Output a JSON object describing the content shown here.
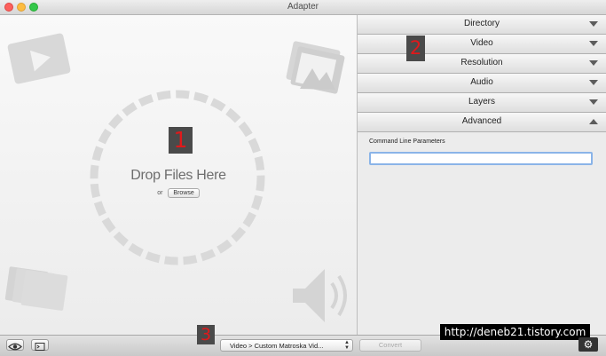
{
  "window": {
    "title": "Adapter"
  },
  "dropzone": {
    "heading": "Drop Files Here",
    "or_text": "or",
    "browse_label": "Browse"
  },
  "annotations": {
    "one": "1",
    "two": "2",
    "three": "3"
  },
  "sections": [
    {
      "label": "Directory",
      "expanded": false
    },
    {
      "label": "Video",
      "expanded": false
    },
    {
      "label": "Resolution",
      "expanded": false
    },
    {
      "label": "Audio",
      "expanded": false
    },
    {
      "label": "Layers",
      "expanded": false
    },
    {
      "label": "Advanced",
      "expanded": true
    }
  ],
  "advanced": {
    "command_line_label": "Command Line Parameters",
    "command_line_value": ""
  },
  "bottom": {
    "preset_value": "Video > Custom Matroska Vid...",
    "convert_label": "Convert"
  },
  "watermark": "http://deneb21.tistory.com",
  "icons": {
    "preview": "eye-icon",
    "terminal": "terminal-icon",
    "settings": "gear-icon"
  }
}
